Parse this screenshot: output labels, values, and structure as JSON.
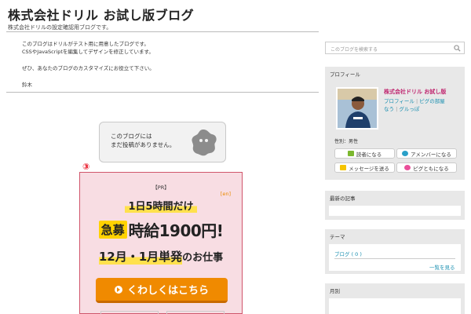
{
  "header": {
    "title": "株式会社ドリル お試し版ブログ",
    "description": "株式会社ドリルの設定確認用ブログです。"
  },
  "intro": {
    "line1": "このブログはドリルがテスト用に用意したブログです。",
    "line2": "CSSやJavaScriptを編集してデザインを修正しています。",
    "line3": "ぜひ、あなたのブログのカスタマイズにお役立て下さい。",
    "signature": "鈴木"
  },
  "no_posts": {
    "line1": "このブログには",
    "line2": "まだ投稿がありません。"
  },
  "ad": {
    "number": "③",
    "pr": "【PR】",
    "badge": "[en]",
    "line1": "1日5時間だけ",
    "tag": "急募",
    "wage": "時給1900円!",
    "line3_big": "12月・1月単発",
    "line3_small": "のお仕事",
    "button_label": "くわしくはこちら",
    "colors": {
      "background": "#f8dde3",
      "border": "#d0566b",
      "button": "#f08a00",
      "highlight": "#ffe14d"
    }
  },
  "sidebar": {
    "search_placeholder": "このブログを検索する",
    "search_icon": "search-icon",
    "profile": {
      "header": "プロフィール",
      "name": "株式会社ドリル お試し版",
      "link_profile": "プロフィール",
      "link_room": "ピグの部屋",
      "link_friend": "なう",
      "link_gurupa": "グルっぽ",
      "gender": "性別：男性",
      "buttons": [
        {
          "label": "読者になる",
          "icon": "reader-icon",
          "color": "#7cb82f"
        },
        {
          "label": "アメンバーになる",
          "icon": "amember-icon",
          "color": "#2aa0c8"
        },
        {
          "label": "メッセージを送る",
          "icon": "message-icon",
          "color": "#f5c400"
        },
        {
          "label": "ピグともになる",
          "icon": "pigg-icon",
          "color": "#ea4f9a"
        }
      ]
    },
    "recent_header": "最新の記事",
    "theme_header": "テーマ",
    "theme_link": "ブログ ( 0 )",
    "theme_more": "一覧を見る",
    "monthly_header": "月別"
  }
}
